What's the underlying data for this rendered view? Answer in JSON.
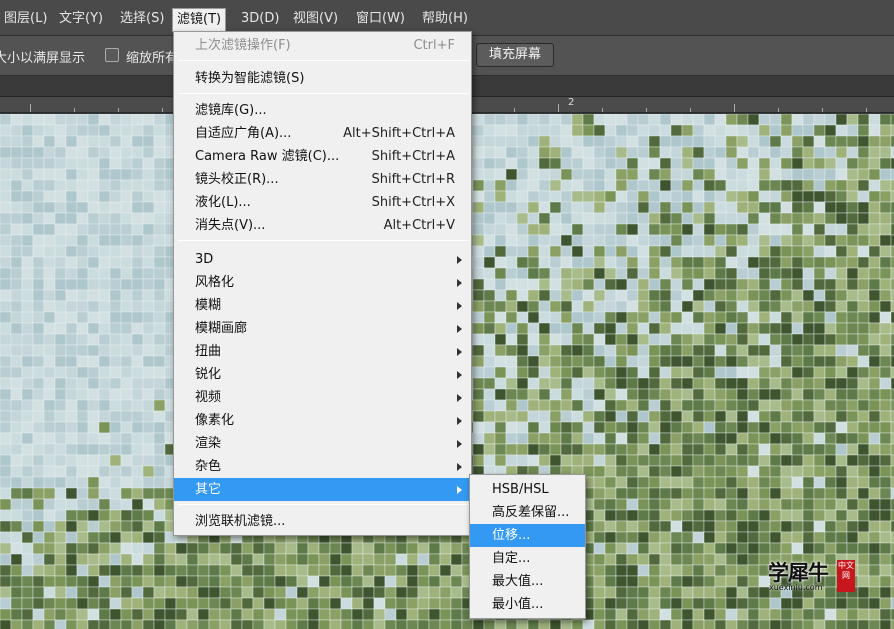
{
  "menubar": {
    "items": [
      "图层(L)",
      "文字(Y)",
      "选择(S)",
      "滤镜(T)",
      "3D(D)",
      "视图(V)",
      "窗口(W)",
      "帮助(H)"
    ]
  },
  "options": {
    "fit_screen_label": "大小以满屏显示",
    "zoom_all_label": "缩放所有",
    "fill_screen_button": "填充屏幕"
  },
  "ruler": {
    "label": "2"
  },
  "filter_menu": {
    "last_filter": {
      "label": "上次滤镜操作(F)",
      "shortcut": "Ctrl+F"
    },
    "smart_filter": "转换为智能滤镜(S)",
    "group1": [
      {
        "label": "滤镜库(G)...",
        "shortcut": ""
      },
      {
        "label": "自适应广角(A)...",
        "shortcut": "Alt+Shift+Ctrl+A"
      },
      {
        "label": "Camera Raw 滤镜(C)...",
        "shortcut": "Shift+Ctrl+A"
      },
      {
        "label": "镜头校正(R)...",
        "shortcut": "Shift+Ctrl+R"
      },
      {
        "label": "液化(L)...",
        "shortcut": "Shift+Ctrl+X"
      },
      {
        "label": "消失点(V)...",
        "shortcut": "Alt+Ctrl+V"
      }
    ],
    "submenus": [
      "3D",
      "风格化",
      "模糊",
      "模糊画廊",
      "扭曲",
      "锐化",
      "视频",
      "像素化",
      "渲染",
      "杂色",
      "其它"
    ],
    "browse_online": "浏览联机滤镜..."
  },
  "other_submenu": {
    "items": [
      "HSB/HSL",
      "高反差保留...",
      "位移...",
      "自定...",
      "最大值...",
      "最小值..."
    ],
    "highlighted": "位移..."
  },
  "watermark": {
    "text": "学犀牛",
    "url": "xuexiniu.com",
    "seal": "中文网"
  },
  "colors": {
    "menu_bg": "#f0f0f0",
    "highlight": "#3399f3",
    "menubar_bg": "#4a4a4a",
    "options_bg": "#535353"
  }
}
